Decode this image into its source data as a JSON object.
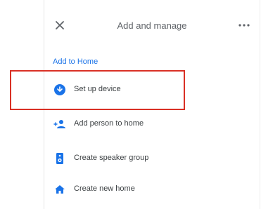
{
  "header": {
    "title": "Add and manage",
    "close_icon": "close-icon",
    "more_icon": "more-options-icon"
  },
  "section": {
    "title": "Add to Home"
  },
  "items": [
    {
      "label": "Set up device",
      "icon": "setup-device-icon"
    },
    {
      "label": "Add person to home",
      "icon": "add-person-icon"
    },
    {
      "label": "Create speaker group",
      "icon": "speaker-group-icon"
    },
    {
      "label": "Create new home",
      "icon": "home-icon"
    }
  ],
  "colors": {
    "accent": "#1a73e8",
    "highlight": "#d93025",
    "text": "#3c4043",
    "muted": "#5f6368"
  }
}
